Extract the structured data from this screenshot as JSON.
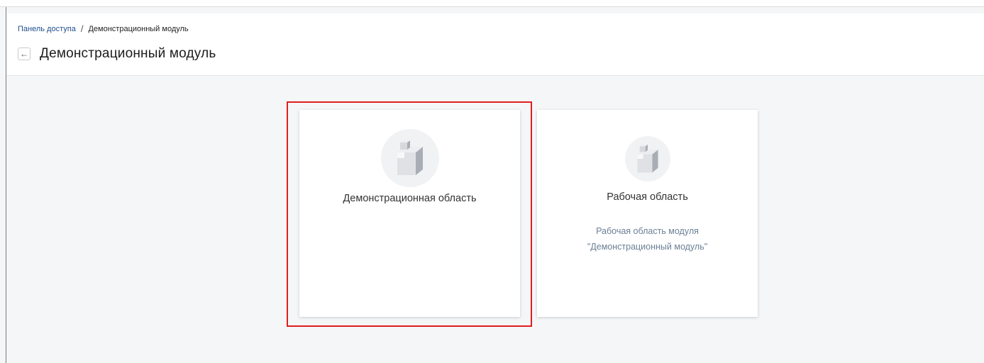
{
  "breadcrumb": {
    "root": "Панель доступа",
    "separator": "/",
    "current": "Демонстрационный модуль"
  },
  "header": {
    "back_icon": "arrow-left-icon",
    "title": "Демонстрационный модуль"
  },
  "cards": [
    {
      "title": "Демонстрационная область",
      "description": "",
      "icon": "cube-icon",
      "highlighted": true
    },
    {
      "title": "Рабочая область",
      "description_line1": "Рабочая область модуля",
      "description_line2": "\"Демонстрационный модуль\"",
      "icon": "cube-icon",
      "highlighted": false
    }
  ],
  "colors": {
    "highlight": "#e01e1e",
    "link": "#1f4e8c",
    "description": "#6b7f95"
  }
}
